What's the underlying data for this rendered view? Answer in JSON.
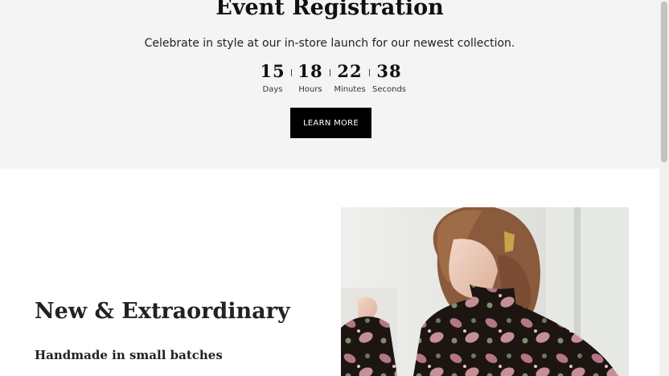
{
  "event": {
    "title": "Event Registration",
    "description": "Celebrate in style at our in-store launch for our newest collection.",
    "countdown": [
      {
        "value": "15",
        "label": "Days"
      },
      {
        "value": "18",
        "label": "Hours"
      },
      {
        "value": "22",
        "label": "Minutes"
      },
      {
        "value": "38",
        "label": "Seconds"
      }
    ],
    "button_label": "LEARN MORE"
  },
  "feature": {
    "heading": "New & Extraordinary",
    "subheading": "Handmade in small batches",
    "image_icon": "woman-in-paisley-blouse-photo"
  },
  "colors": {
    "event_background": "#f4f4f4",
    "button_background": "#000000",
    "button_text": "#ffffff"
  }
}
